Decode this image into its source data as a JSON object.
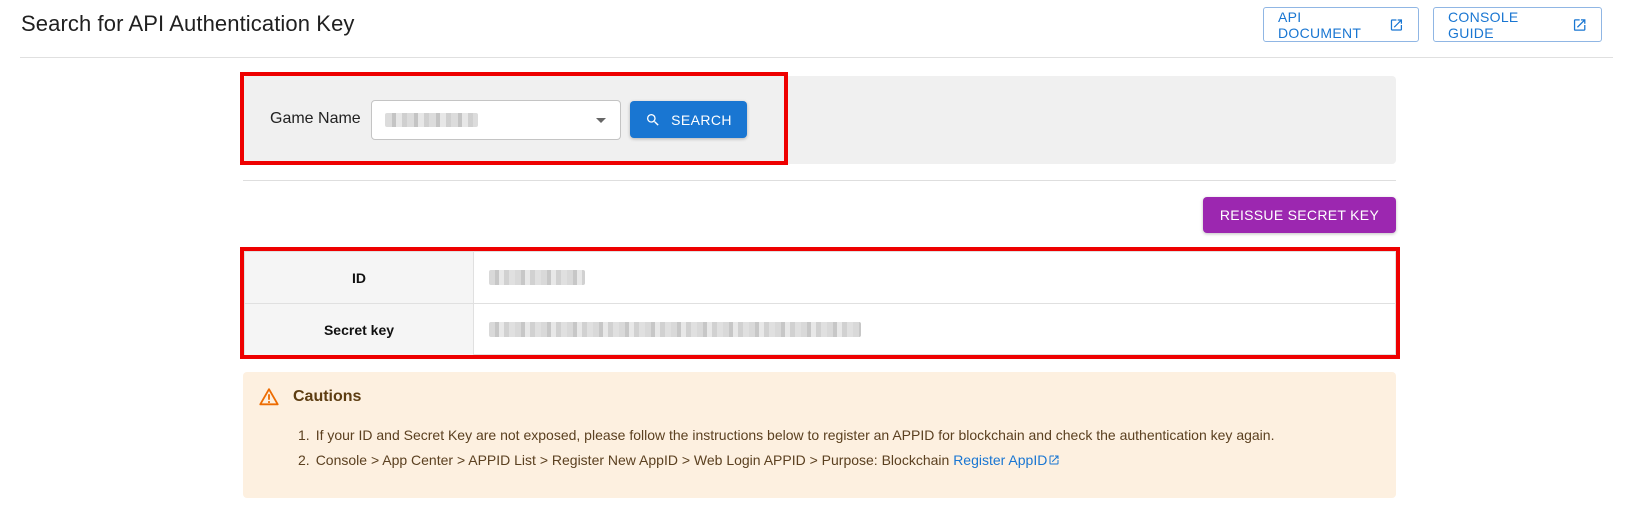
{
  "header": {
    "title": "Search for API Authentication Key",
    "api_document_label": "API DOCUMENT",
    "console_guide_label": "CONSOLE GUIDE"
  },
  "search": {
    "game_name_label": "Game Name",
    "search_label": "SEARCH"
  },
  "actions": {
    "reissue_label": "REISSUE SECRET KEY"
  },
  "credentials": {
    "rows": [
      {
        "label": "ID"
      },
      {
        "label": "Secret key"
      }
    ]
  },
  "cautions": {
    "title": "Cautions",
    "items": [
      {
        "num": "1.",
        "text": "If your ID and Secret Key are not exposed, please follow the instructions below to register an APPID for blockchain and check the authentication key again."
      },
      {
        "num": "2.",
        "text": "Console > App Center > APPID List > Register New AppID > Web Login APPID > Purpose: Blockchain ",
        "link": "Register AppID"
      }
    ]
  },
  "icons": {
    "external": "open-in-new-icon",
    "search": "search-icon",
    "warning": "warning-icon",
    "dropdown": "chevron-down-icon"
  },
  "colors": {
    "primary": "#1976d2",
    "secondary": "#9c27b0",
    "highlight": "#ee0000",
    "caution_bg": "#fdf0e0"
  }
}
